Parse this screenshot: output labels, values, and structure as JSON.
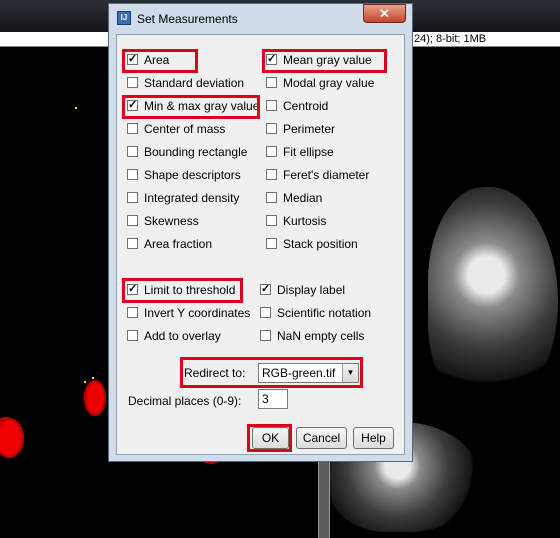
{
  "background": {
    "image_info": "24); 8-bit; 1MB"
  },
  "dialog": {
    "title": "Set Measurements",
    "close_glyph": "✕",
    "icon_glyph": "IJ",
    "measurements_left": [
      {
        "label": "Area",
        "checked": true
      },
      {
        "label": "Standard deviation",
        "checked": false
      },
      {
        "label": "Min & max gray value",
        "checked": true
      },
      {
        "label": "Center of mass",
        "checked": false
      },
      {
        "label": "Bounding rectangle",
        "checked": false
      },
      {
        "label": "Shape descriptors",
        "checked": false
      },
      {
        "label": "Integrated density",
        "checked": false
      },
      {
        "label": "Skewness",
        "checked": false
      },
      {
        "label": "Area fraction",
        "checked": false
      }
    ],
    "measurements_right": [
      {
        "label": "Mean gray value",
        "checked": true
      },
      {
        "label": "Modal gray value",
        "checked": false
      },
      {
        "label": "Centroid",
        "checked": false
      },
      {
        "label": "Perimeter",
        "checked": false
      },
      {
        "label": "Fit ellipse",
        "checked": false
      },
      {
        "label": "Feret's diameter",
        "checked": false
      },
      {
        "label": "Median",
        "checked": false
      },
      {
        "label": "Kurtosis",
        "checked": false
      },
      {
        "label": "Stack position",
        "checked": false
      }
    ],
    "options_left": [
      {
        "label": "Limit to threshold",
        "checked": true
      },
      {
        "label": "Invert Y coordinates",
        "checked": false
      },
      {
        "label": "Add to overlay",
        "checked": false
      }
    ],
    "options_right": [
      {
        "label": "Display label",
        "checked": true
      },
      {
        "label": "Scientific notation",
        "checked": false
      },
      {
        "label": "NaN empty cells",
        "checked": false
      }
    ],
    "redirect_label": "Redirect to:",
    "redirect_value": "RGB-green.tif",
    "decimal_label": "Decimal places (0-9):",
    "decimal_value": "3",
    "ok_label": "OK",
    "cancel_label": "Cancel",
    "help_label": "Help"
  },
  "colors": {
    "highlight": "#e0001a",
    "dialog_frame": "#cfdcea",
    "client_bg": "#f0f0f0"
  }
}
